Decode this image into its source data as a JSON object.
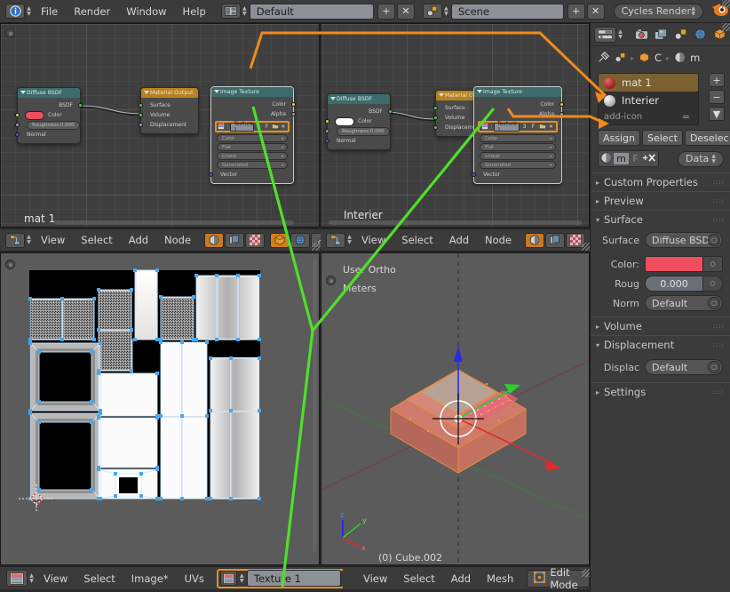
{
  "topbar": {
    "info_icon": "blender-info-icon",
    "menus": [
      "File",
      "Render",
      "Window",
      "Help"
    ],
    "layout_icon": "screen-layout-icon",
    "screen_name": "Default",
    "add_label": "+",
    "close_label": "✕",
    "scene_icon": "scene-icon",
    "scene_name": "Scene",
    "engine": "Cycles Render",
    "blender_logo": "blender-logo-icon"
  },
  "node_editor_left": {
    "editor_icon": "node-editor-icon",
    "menus": [
      "View",
      "Select",
      "Add",
      "Node"
    ],
    "shader_type_icons": [
      "sphere-material-icon",
      "world-copy-icon",
      "checker-texture-icon"
    ],
    "slot_icons": [
      "object-cube-icon",
      "world-globe-icon",
      "brush-icon"
    ],
    "material_label": "mat 1",
    "nodes": [
      {
        "title": "Diffuse BSDF",
        "header_color": "teal",
        "outputs": [
          "BSDF"
        ],
        "color_label": "Color",
        "color_swatch": "#ef4e5e",
        "rows": [
          {
            "label": "Roughness:",
            "value": "0.000"
          },
          {
            "label": "Normal"
          }
        ]
      },
      {
        "title": "Material Output",
        "header_color": "orange",
        "inputs": [
          "Surface",
          "Volume",
          "Displacement"
        ]
      },
      {
        "title": "Image Texture",
        "header_color": "teal",
        "outputs": [
          "Color",
          "Alpha"
        ],
        "image_name": "Texture 1",
        "image_users": "3",
        "image_fake": "F",
        "image_icons": [
          "image-browse-icon",
          "image-open-icon",
          "image-unlink-icon"
        ],
        "dropdowns": [
          "Color",
          "Flat",
          "Linear",
          "Generated"
        ],
        "inputs": [
          "Vector"
        ]
      }
    ]
  },
  "node_editor_right": {
    "editor_icon": "node-editor-icon",
    "menus": [
      "View",
      "Select",
      "Add",
      "Node"
    ],
    "shader_type_icons": [
      "sphere-material-icon",
      "world-copy-icon",
      "checker-texture-icon"
    ],
    "material_label": "Interier",
    "nodes": [
      {
        "title": "Diffuse BSDF",
        "header_color": "teal",
        "outputs": [
          "BSDF"
        ],
        "color_label": "Color",
        "color_swatch": "#ffffff",
        "rows": [
          {
            "label": "Roughness:",
            "value": "0.000"
          },
          {
            "label": "Normal"
          }
        ]
      },
      {
        "title": "Material Output",
        "header_color": "orange",
        "inputs": [
          "Surface",
          "Volume",
          "Displacement"
        ]
      },
      {
        "title": "Image Texture",
        "header_color": "teal",
        "outputs": [
          "Color",
          "Alpha"
        ],
        "image_name": "Texture 1",
        "image_users": "3",
        "image_fake": "F",
        "image_icons": [
          "image-browse-icon",
          "image-open-icon",
          "image-unlink-icon"
        ],
        "dropdowns": [
          "Color",
          "Flat",
          "Linear",
          "Generated"
        ],
        "inputs": [
          "Vector"
        ]
      }
    ]
  },
  "uv_editor": {
    "editor_icon": "uv-image-editor-icon",
    "menus": [
      "View",
      "Select",
      "Image*",
      "UVs"
    ],
    "image_icon": "image-datablock-icon",
    "image_name": "Texture 1"
  },
  "viewport3d": {
    "view_label": "User Ortho",
    "unit_label": "Meters",
    "object_label": "(0) Cube.002",
    "axis_labels": [
      "x",
      "y",
      "z"
    ],
    "menus": [
      "View",
      "Select",
      "Add",
      "Mesh"
    ],
    "mode_icon": "edit-mode-icon",
    "mode": "Edit Mode"
  },
  "properties": {
    "editor_icon": "properties-editor-icon",
    "tabs": [
      {
        "name": "render-tab",
        "icon": "camera-back-icon",
        "active": false
      },
      {
        "name": "render-layers-tab",
        "icon": "images-icon",
        "active": false
      },
      {
        "name": "scene-tab",
        "icon": "scene-data-icon",
        "active": false
      },
      {
        "name": "world-tab",
        "icon": "world-globe-icon",
        "active": false
      },
      {
        "name": "object-tab",
        "icon": "object-cube-icon",
        "active": false
      }
    ],
    "breadcrumb": {
      "pin_icon": "pin-icon",
      "scene_icon": "scene-data-icon",
      "object_icon": "object-cube-icon",
      "object_name": "C",
      "material_icon": "material-sphere-icon",
      "material_name": "m"
    },
    "material_slots": [
      {
        "name": "mat 1",
        "sphere": "red",
        "selected": true
      },
      {
        "name": "Interier",
        "sphere": "white",
        "selected": false
      }
    ],
    "slot_buttons": [
      "+",
      "−",
      "▼"
    ],
    "datablock_row": {
      "new_icon": "add-icon",
      "dash": "="
    },
    "assign_buttons": [
      "Assign",
      "Select",
      "Deselec"
    ],
    "link_row": {
      "material_icon": "material-sphere-icon",
      "name": "m",
      "fake_user": "F",
      "unlink_icon": "unlink-x-icon",
      "link_mode": "Data"
    },
    "panels": [
      {
        "label": "Custom Properties",
        "open": false
      },
      {
        "label": "Preview",
        "open": false
      },
      {
        "label": "Surface",
        "open": true
      },
      {
        "label": "Volume",
        "open": false
      },
      {
        "label": "Displacement",
        "open": true
      },
      {
        "label": "Settings",
        "open": false
      }
    ],
    "surface": {
      "surface_label": "Surface",
      "surface_value": "Diffuse BSDF",
      "color_label": "Color:",
      "color_value": "#ef4e5e",
      "roughness_label": "Roug",
      "roughness_value": "0.000",
      "normal_label": "Norm",
      "normal_value": "Default"
    },
    "displacement": {
      "label": "Displac",
      "value": "Default"
    }
  },
  "colors": {
    "accent_orange": "#e89020",
    "link_green": "#4fe02a",
    "node_teal": "#3b6b6b",
    "node_orange": "#b9821f",
    "panel_bg": "#3b3b3b",
    "canvas_bg": "#3f3f3f"
  }
}
